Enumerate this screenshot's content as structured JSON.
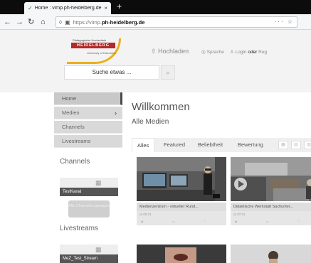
{
  "browser": {
    "tab_title": "Home : vimp.ph-heidelberg.de",
    "tab_close": "×",
    "new_tab": "+",
    "url_prefix": "https://vimp.",
    "url_domain": "ph-heidelberg.de",
    "url_actions": "··· ☆",
    "nav": {
      "back": "←",
      "forward": "→",
      "reload": "↻",
      "home": "⌂"
    }
  },
  "header": {
    "logo_sub": "Pädagogische Hochschule",
    "logo_name": "HEIDELBERG",
    "logo_small": "University of Education",
    "upload": "Hochladen",
    "language": "Sprache",
    "login": "Login",
    "or": "oder",
    "register": "Reg"
  },
  "search": {
    "placeholder": "Suche etwas ..."
  },
  "sidebar": {
    "items": [
      {
        "label": "Home"
      },
      {
        "label": "Medien",
        "chevron": "›"
      },
      {
        "label": "Channels"
      },
      {
        "label": "Livestreams"
      }
    ],
    "channels_title": "Channels",
    "channel_card": "TestKanal",
    "show_all_channels": "Alle Channels anzeigen",
    "livestreams_title": "Livestreams",
    "stream_card": "MeZ_Test_Stream"
  },
  "main": {
    "title": "Willkommen",
    "subtitle": "Alle Medien",
    "tabs": [
      "Alles",
      "Featured",
      "Beliebtheit",
      "Bewertung"
    ],
    "cards": [
      {
        "title": "Medienzentrum - virtueller Rund...",
        "date": "00:21"
      },
      {
        "title": "Didaktische Werkstatt Sachunter...",
        "date": "07:21"
      }
    ]
  },
  "colors": {
    "accent_red": "#b22a2a",
    "logo_yellow": "#e8b020",
    "sidebar_bg": "#d9d9d9"
  }
}
